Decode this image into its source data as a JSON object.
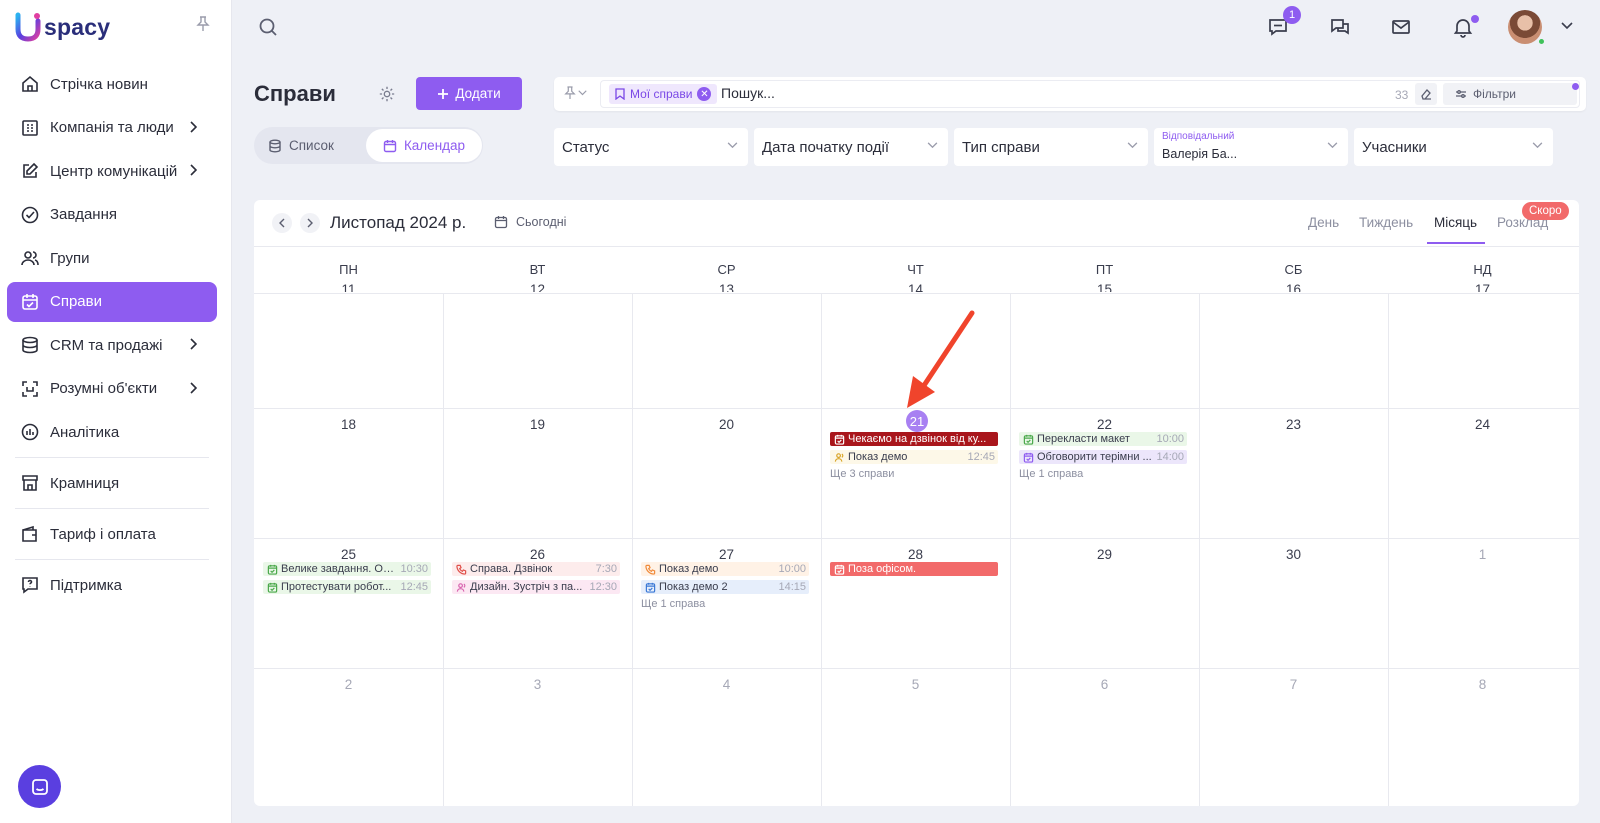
{
  "brand": {
    "logo_text": "spacy"
  },
  "sidebar": {
    "items": [
      {
        "label": "Стрічка новин",
        "icon": "home-icon"
      },
      {
        "label": "Компанія та люди",
        "icon": "building-icon",
        "has_submenu": true
      },
      {
        "label": "Центр комунікацій",
        "icon": "edit-icon",
        "has_submenu": true
      },
      {
        "label": "Завдання",
        "icon": "check-circle-icon"
      },
      {
        "label": "Групи",
        "icon": "users-icon"
      },
      {
        "label": "Справи",
        "icon": "calendar-check-icon",
        "active": true
      },
      {
        "label": "CRM та продажі",
        "icon": "database-icon",
        "has_submenu": true
      },
      {
        "label": "Розумні об'єкти",
        "icon": "scan-icon",
        "has_submenu": true
      },
      {
        "label": "Аналітика",
        "icon": "chart-circle-icon"
      },
      {
        "label": "Крамниця",
        "icon": "store-icon"
      },
      {
        "label": "Тариф і оплата",
        "icon": "wallet-icon"
      },
      {
        "label": "Підтримка",
        "icon": "help-icon"
      }
    ]
  },
  "topbar": {
    "messages_badge": "1"
  },
  "header": {
    "title": "Справи",
    "add_label": "Додати",
    "view_list": "Список",
    "view_calendar": "Календар"
  },
  "search": {
    "chip": "Мої справи",
    "placeholder": "Пошук...",
    "count": "33",
    "filters_label": "Фільтри"
  },
  "filters": {
    "status": "Статус",
    "start_date": "Дата початку події",
    "type": "Тип справи",
    "responsible_label": "Відповідальний",
    "responsible_value": "Валерія Ба...",
    "participants": "Учасники"
  },
  "calendar": {
    "month_title": "Листопад 2024 р.",
    "today_label": "Сьогодні",
    "views": [
      "День",
      "Тиждень",
      "Місяць",
      "Розклад"
    ],
    "active_view": "Місяць",
    "soon_badge": "Скоро",
    "weekdays": [
      "ПН",
      "ВТ",
      "СР",
      "ЧТ",
      "ПТ",
      "СБ",
      "НД"
    ],
    "week_partial": [
      "11",
      "12",
      "13",
      "14",
      "15",
      "16",
      "17"
    ],
    "weeks": [
      [
        "18",
        "19",
        "20",
        "21",
        "22",
        "23",
        "24"
      ],
      [
        "25",
        "26",
        "27",
        "28",
        "29",
        "30",
        "1"
      ],
      [
        "2",
        "3",
        "4",
        "5",
        "6",
        "7",
        "8"
      ]
    ],
    "today": "21",
    "events": {
      "thu21": [
        {
          "title": "Чекаємо на дзвінок від ку...",
          "time": "",
          "color": "#a9161c",
          "text": "#ffffff",
          "icon": "calendar-check-icon"
        },
        {
          "title": "Показ демо",
          "time": "12:45",
          "color": "#fdf8e8",
          "text": "#3a3d4d",
          "icon": "users-icon"
        }
      ],
      "thu21_more": "Ще 3 справи",
      "fri22": [
        {
          "title": "Перекласти макет",
          "time": "10:00",
          "color": "#eaf7e8",
          "text": "#3a3d4d",
          "icon": "calendar-check-icon"
        },
        {
          "title": "Обговорити терімни ...",
          "time": "14:00",
          "color": "#ece6fb",
          "text": "#3a3d4d",
          "icon": "calendar-check-icon"
        }
      ],
      "fri22_more": "Ще 1 справа",
      "mon25": [
        {
          "title": "Велике завдання. Об...",
          "time": "10:30",
          "color": "#eaf7e8",
          "text": "#3a3d4d",
          "icon": "calendar-check-icon"
        },
        {
          "title": "Протестувати робот...",
          "time": "12:45",
          "color": "#eaf7e8",
          "text": "#3a3d4d",
          "icon": "calendar-check-icon"
        }
      ],
      "tue26": [
        {
          "title": "Справа. Дзвінок",
          "time": "7:30",
          "color": "#fdecec",
          "text": "#3a3d4d",
          "icon": "phone-icon"
        },
        {
          "title": "Дизайн. Зустріч з па...",
          "time": "12:30",
          "color": "#fce8f3",
          "text": "#3a3d4d",
          "icon": "users-icon"
        }
      ],
      "wed27": [
        {
          "title": "Показ демо",
          "time": "10:00",
          "color": "#fff2e6",
          "text": "#3a3d4d",
          "icon": "phone-icon"
        },
        {
          "title": "Показ демо 2",
          "time": "14:15",
          "color": "#e6eefb",
          "text": "#3a3d4d",
          "icon": "calendar-check-icon"
        }
      ],
      "wed27_more": "Ще 1 справа",
      "thu28": [
        {
          "title": "Поза офісом.",
          "time": "",
          "color": "#f26a6a",
          "text": "#ffffff",
          "icon": "calendar-check-icon"
        }
      ]
    }
  },
  "colors": {
    "accent": "#8e5cf0",
    "brand_dark": "#2a2e7a",
    "arrow": "#f0442c"
  }
}
